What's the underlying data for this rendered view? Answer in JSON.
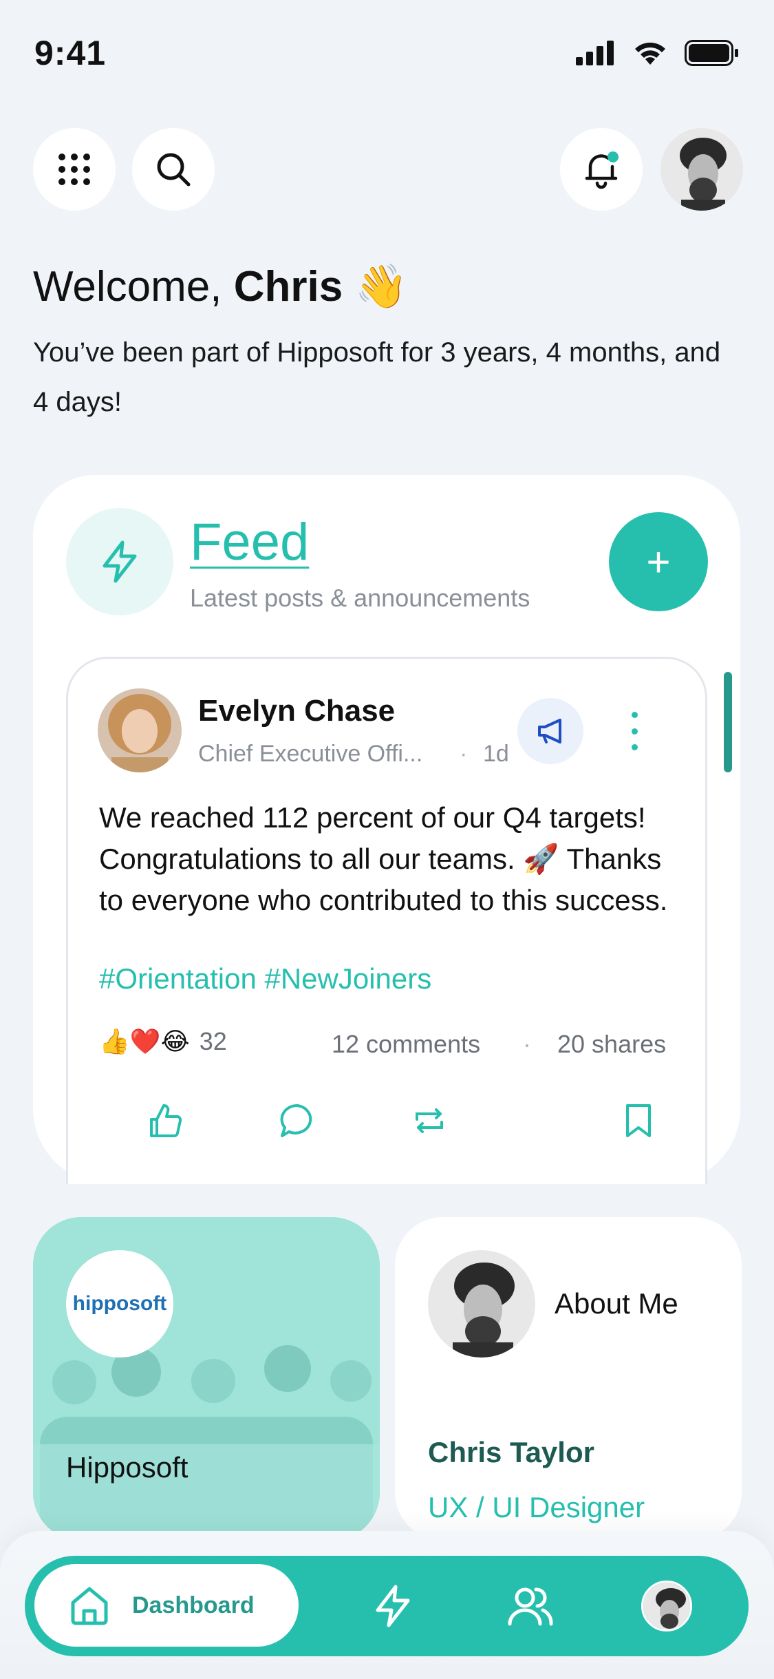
{
  "status_bar": {
    "time": "9:41"
  },
  "header": {
    "welcome_prefix": "Welcome, ",
    "user_name": "Chris",
    "wave_emoji": "👋",
    "tenure_text": "You’ve been part of Hipposoft for 3 years, 4 months, and 4 days!"
  },
  "feed": {
    "title": "Feed",
    "subtitle": "Latest posts & announcements",
    "add_label": "+"
  },
  "post": {
    "author": "Evelyn Chase",
    "role": "Chief Executive Offi...",
    "dot": "·",
    "time": "1d",
    "body": "We reached 112 percent of our Q4 targets! Congratulations to all our teams. 🚀 Thanks to everyone who contributed to this success.",
    "tags": "#Orientation #NewJoiners",
    "reactions_emoji": "👍❤️😂",
    "reaction_count": "32",
    "comments": "12 comments",
    "sep": "·",
    "shares": "20 shares"
  },
  "company": {
    "logo_text": "hipposoft",
    "name": "Hipposoft"
  },
  "about": {
    "title": "About Me",
    "name": "Chris Taylor",
    "role": "UX / UI Designer"
  },
  "nav": {
    "home_label": "Dashboard"
  },
  "colors": {
    "accent": "#26bfae",
    "accent_dark": "#26998c",
    "background": "#f0f4f8",
    "announce_blue": "#1e4fc2"
  },
  "icons": [
    "grid-icon",
    "search-icon",
    "bell-icon",
    "lightning-icon",
    "megaphone-icon",
    "like-icon",
    "comment-icon",
    "repost-icon",
    "bookmark-icon",
    "home-icon",
    "people-icon"
  ]
}
